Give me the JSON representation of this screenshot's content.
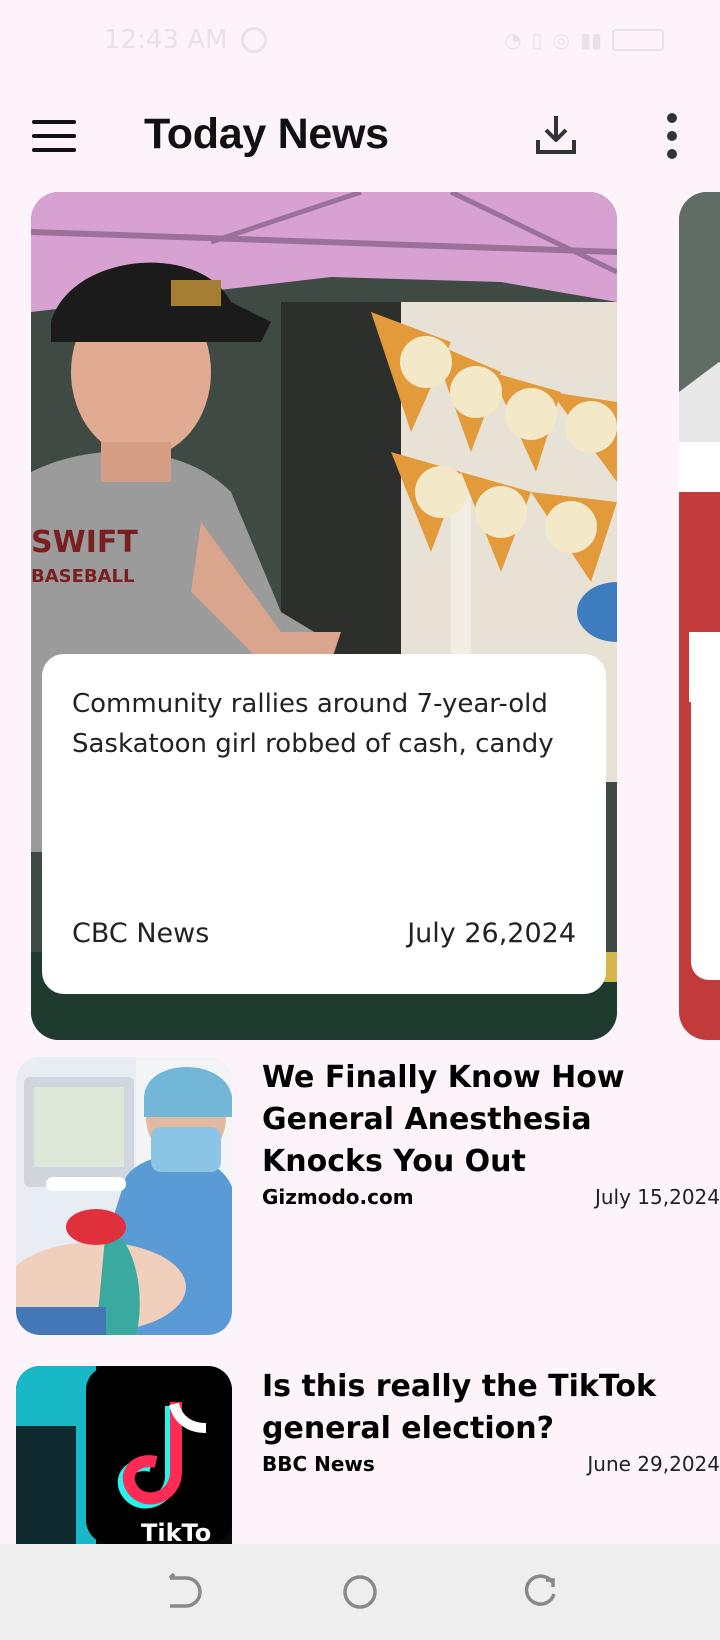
{
  "status_bar": {
    "time": "12:43 AM"
  },
  "app_bar": {
    "title": "Today News"
  },
  "featured": {
    "title": "Community rallies around 7-year-old Saskatoon girl robbed of cash, candy …",
    "source": "CBC News",
    "date": "July 26,2024"
  },
  "news": [
    {
      "title": "We Finally Know How General Anesthesia Knocks You Out",
      "source": "Gizmodo.com",
      "date": "July 15,2024"
    },
    {
      "title": "Is this really the TikTok general election?",
      "source": "BBC News",
      "date": "June 29,2024"
    }
  ]
}
